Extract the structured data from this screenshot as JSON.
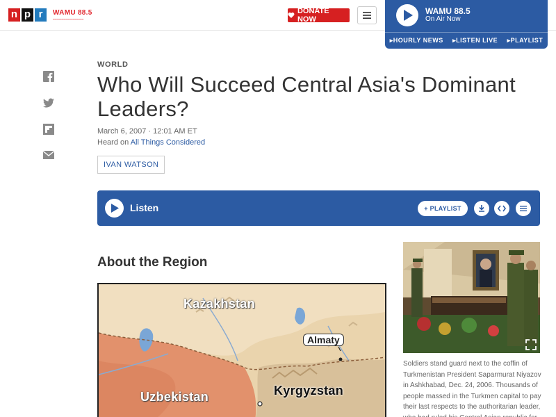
{
  "header": {
    "logo_letters": [
      "n",
      "p",
      "r"
    ],
    "station_logo": "WAMU 88.5",
    "donate_label": "DONATE NOW",
    "player": {
      "station": "WAMU 88.5",
      "status": "On Air Now",
      "links": [
        "HOURLY NEWS",
        "LISTEN LIVE",
        "PLAYLIST"
      ]
    }
  },
  "share": {
    "icons": [
      "facebook-icon",
      "twitter-icon",
      "flipboard-icon",
      "email-icon"
    ]
  },
  "article": {
    "section": "WORLD",
    "title": "Who Will Succeed Central Asia's Dominant Leaders?",
    "date": "March 6, 2007 · 12:01 AM ET",
    "heard_on_prefix": "Heard on ",
    "heard_on_program": "All Things Considered",
    "byline": "IVAN WATSON"
  },
  "audio": {
    "label": "Listen",
    "playlist_label": "+ PLAYLIST",
    "icons": [
      "download-icon",
      "embed-icon",
      "transcript-icon"
    ]
  },
  "region": {
    "heading": "About the Region",
    "map_labels": {
      "kazakhstan": "Kazakhstan",
      "uzbekistan": "Uzbekistan",
      "kyrgyzstan": "Kyrgyzstan",
      "almaty": "Almaty"
    }
  },
  "photo": {
    "caption": "Soldiers stand guard next to the coffin of Turkmenistan President Saparmurat Niyazov in Ashkhabad, Dec. 24, 2006. Thousands of people massed in the Turkmen capital to pay their last respects to the authoritarian leader, who had ruled his Central Asian republic for"
  },
  "colors": {
    "brand_blue": "#2c5ba3",
    "npr_red": "#d62021",
    "npr_blue": "#237bbd"
  }
}
